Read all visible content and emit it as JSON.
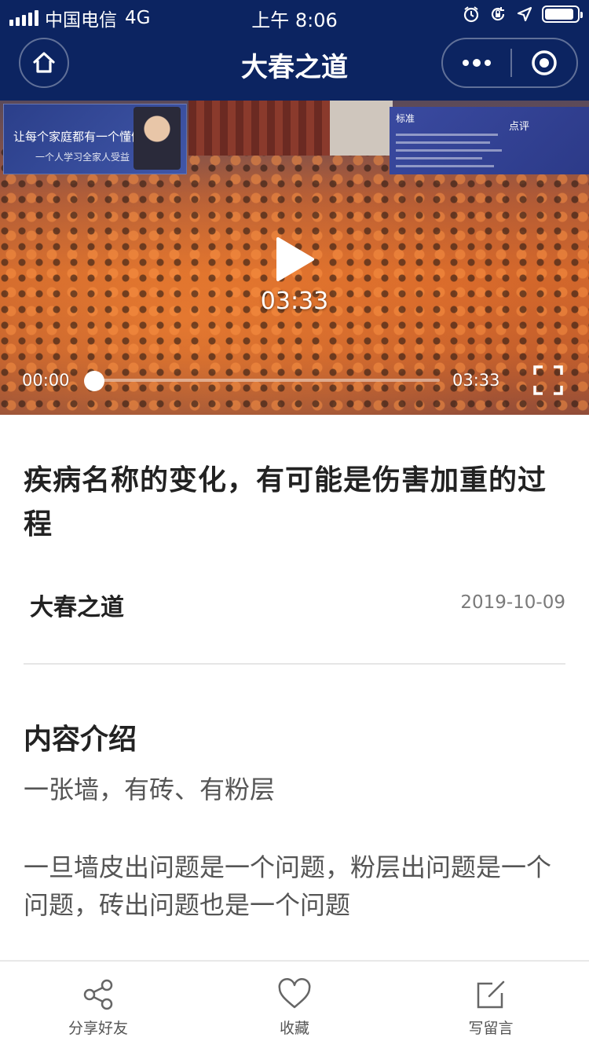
{
  "status_bar": {
    "carrier": "中国电信",
    "network": "4G",
    "time": "上午 8:06",
    "battery_level": 0.9
  },
  "nav": {
    "title": "大春之道",
    "home_icon": "home-icon",
    "more_icon": "more-dots-icon",
    "close_icon": "target-close-icon"
  },
  "video": {
    "center_duration": "03:33",
    "current_time": "00:00",
    "total_time": "03:33",
    "progress": 0,
    "banner_left_text": "让每个家庭都有一个懂健康的人",
    "banner_left_sub": "一个人学习全家人受益",
    "banner_right_h1": "标准",
    "banner_right_h2": "点评"
  },
  "article": {
    "title": "疾病名称的变化，有可能是伤害加重的过程",
    "author": "大春之道",
    "date": "2019-10-09",
    "section_title": "内容介绍",
    "paragraphs": [
      "一张墙，有砖、有粉层",
      "一旦墙皮出问题是一个问题，粉层出问题是一个问题，砖出问题也是一个问题"
    ]
  },
  "bottom_bar": {
    "tabs": [
      {
        "label": "分享好友",
        "icon": "share-icon"
      },
      {
        "label": "收藏",
        "icon": "heart-icon"
      },
      {
        "label": "写留言",
        "icon": "edit-icon"
      }
    ]
  },
  "colors": {
    "header_bg": "#0c2461",
    "text_primary": "#222222",
    "text_secondary": "#555555",
    "date_gray": "#7a7a7a"
  }
}
